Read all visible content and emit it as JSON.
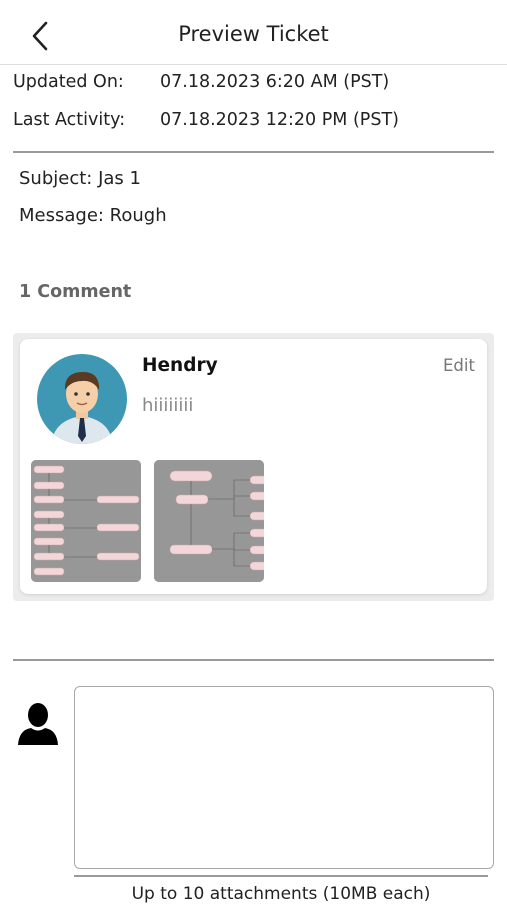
{
  "header": {
    "title": "Preview Ticket",
    "back_icon": "chevron-left-icon"
  },
  "meta": {
    "updated_label": "Updated On:",
    "updated_value": "07.18.2023 6:20 AM (PST)",
    "activity_label": "Last Activity:",
    "activity_value": "07.18.2023 12:20 PM (PST)"
  },
  "ticket": {
    "subject": "Subject: Jas 1",
    "message": "Message: Rough"
  },
  "comments": {
    "count_label": "1 Comment",
    "items": [
      {
        "author": "Hendry",
        "edit_label": "Edit",
        "text": "hiiiiiiii",
        "attachments": [
          "flowchart-thumbnail-1",
          "flowchart-thumbnail-2"
        ]
      }
    ]
  },
  "reply": {
    "placeholder": "",
    "attachments_note": "Up to 10 attachments (10MB each)",
    "user_icon": "user-silhouette-icon"
  }
}
